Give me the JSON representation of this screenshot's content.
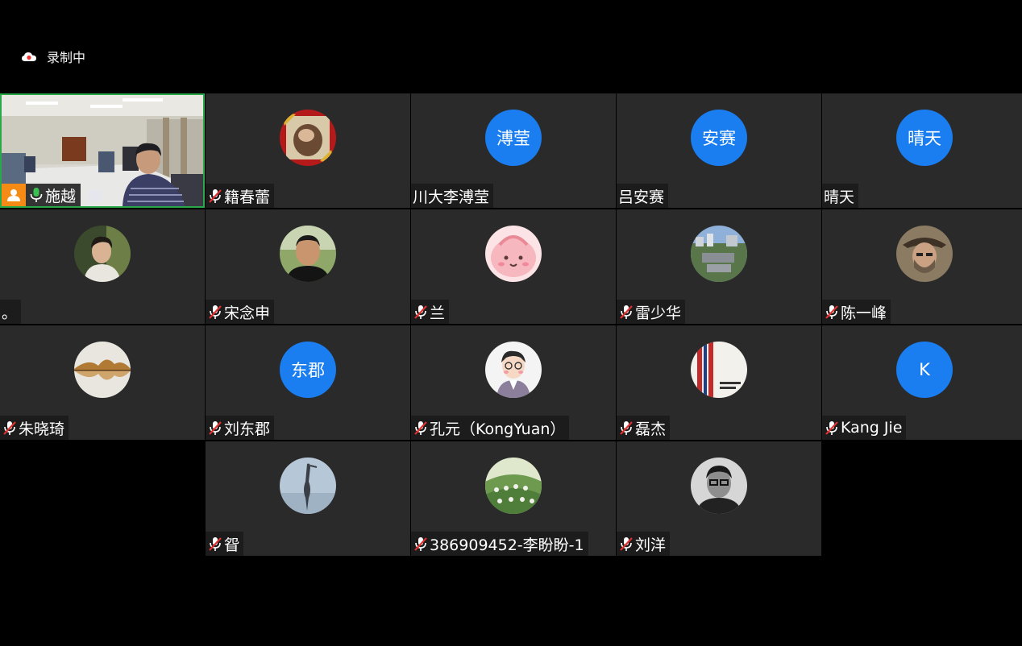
{
  "recording": {
    "label": "录制中",
    "icon": "cloud-record-icon"
  },
  "colors": {
    "background": "#000000",
    "tile": "#2a2a2a",
    "active_border": "#2aa84a",
    "text_avatar": "#1a7df0",
    "host_badge": "#f58a14",
    "mic_muted": "#e03030"
  },
  "participants": [
    {
      "name": "施越",
      "muted": false,
      "host": true,
      "speaking": true,
      "video": "meeting-room-video"
    },
    {
      "name": "籍春蕾",
      "muted": true,
      "avatar": "photo-red-frame-avatar"
    },
    {
      "name": "川大李溥莹",
      "muted": false,
      "avatar_text": "溥莹"
    },
    {
      "name": "吕安赛",
      "muted": false,
      "avatar_text": "安赛"
    },
    {
      "name": "晴天",
      "muted": false,
      "avatar_text": "晴天"
    },
    {
      "name": "。",
      "muted": false,
      "avatar": "photo-young-man-avatar"
    },
    {
      "name": "宋念申",
      "muted": true,
      "avatar": "photo-man-avatar"
    },
    {
      "name": "兰",
      "muted": true,
      "avatar": "pink-cartoon-avatar"
    },
    {
      "name": "雷少华",
      "muted": true,
      "avatar": "campus-aerial-avatar"
    },
    {
      "name": "陈一峰",
      "muted": true,
      "avatar": "bearded-man-hat-avatar"
    },
    {
      "name": "朱晓琦",
      "muted": true,
      "avatar": "golden-reflection-avatar"
    },
    {
      "name": "刘东郡",
      "muted": true,
      "avatar_text": "东郡"
    },
    {
      "name": "孔元（KongYuan）",
      "muted": true,
      "avatar": "cartoon-man-avatar"
    },
    {
      "name": "磊杰",
      "muted": true,
      "avatar": "book-cover-avatar"
    },
    {
      "name": "Kang Jie",
      "muted": true,
      "avatar_text": "K"
    },
    {
      "name": "眢",
      "muted": true,
      "avatar": "heron-avatar"
    },
    {
      "name": "386909452-李盼盼-1",
      "muted": true,
      "avatar": "green-field-avatar"
    },
    {
      "name": "刘洋",
      "muted": true,
      "avatar": "bw-glasses-man-avatar"
    }
  ]
}
